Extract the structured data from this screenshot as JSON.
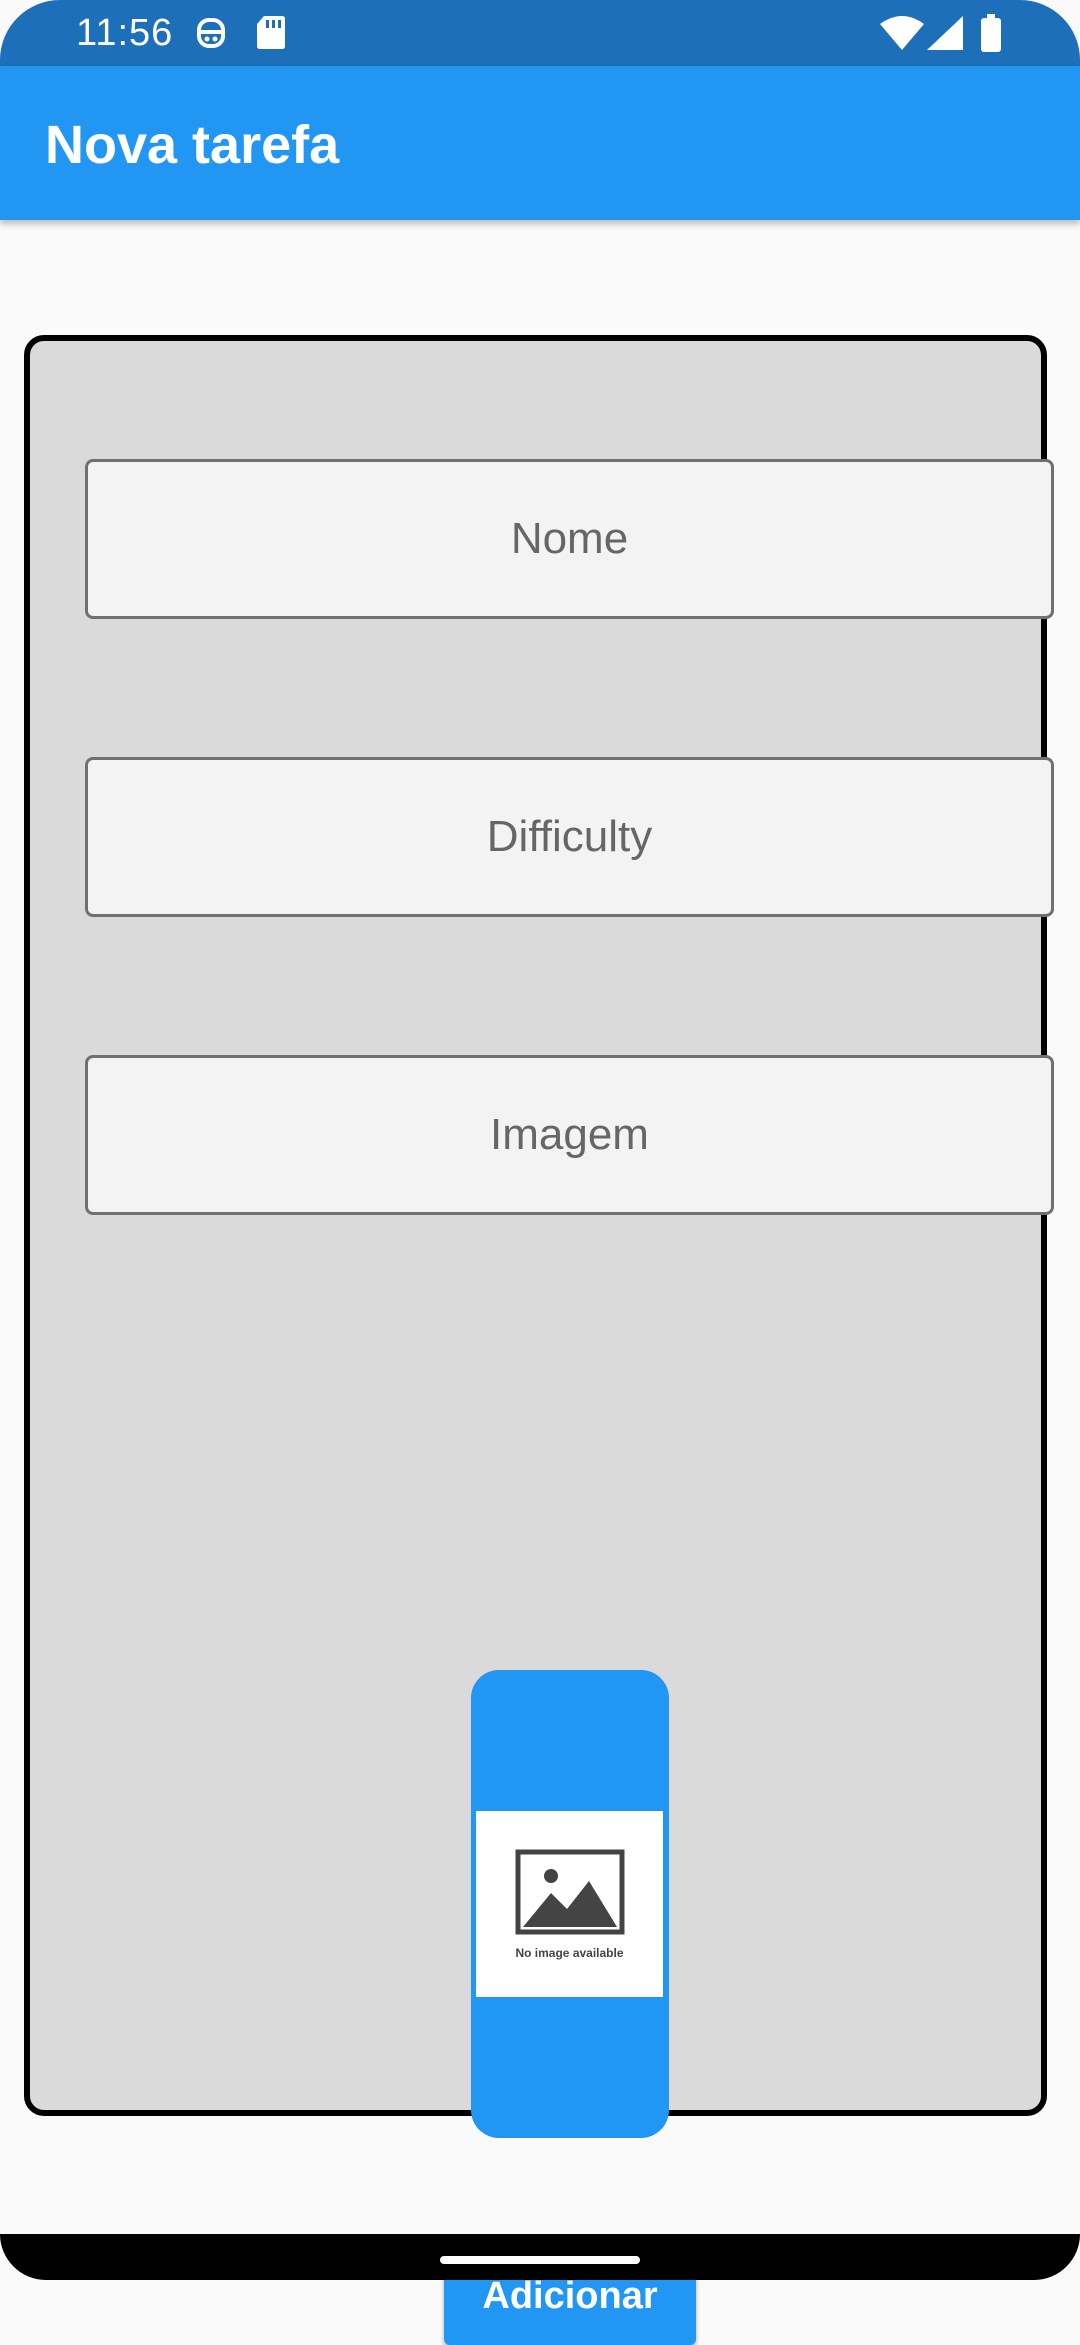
{
  "status_bar": {
    "time": "11:56",
    "icons": [
      "face-notification-icon",
      "sd-card-icon",
      "wifi-icon",
      "signal-icon",
      "battery-icon"
    ]
  },
  "app_bar": {
    "title": "Nova tarefa",
    "color": "#2196f3"
  },
  "form": {
    "fields": [
      {
        "placeholder": "Nome",
        "value": ""
      },
      {
        "placeholder": "Difficulty",
        "value": ""
      },
      {
        "placeholder": "Imagem",
        "value": ""
      }
    ],
    "image_preview": {
      "icon": "no-image-icon",
      "text": "No image available"
    },
    "submit_label": "Adicionar"
  },
  "colors": {
    "accent": "#2196f3",
    "status_bar": "#1c6fb8",
    "card_background": "#dadada",
    "card_border": "#000000"
  }
}
